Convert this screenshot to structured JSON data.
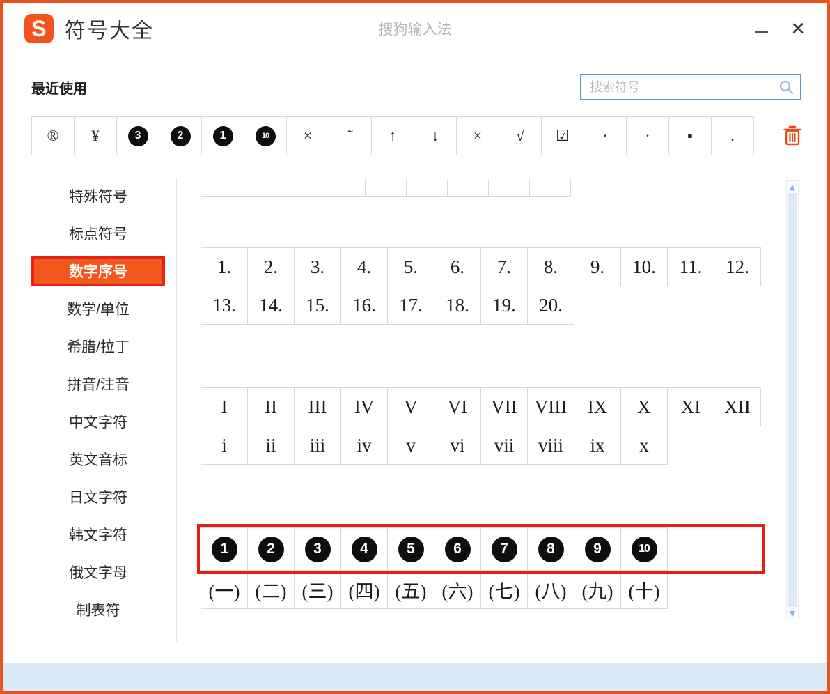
{
  "colors": {
    "accent_orange": "#e9511d",
    "highlight_red": "#e71f19",
    "search_border_blue": "#5b97d5",
    "selected_item_bg": "#f2571e"
  },
  "window": {
    "title": "符号大全",
    "center_title": "搜狗输入法",
    "close_glyph": "✕"
  },
  "toolbar": {
    "recent_label": "最近使用",
    "search_placeholder": "搜索符号"
  },
  "recent": {
    "symbols": [
      {
        "glyph": "®",
        "style": "plain"
      },
      {
        "glyph": "¥",
        "style": "plain"
      },
      {
        "glyph": "3",
        "style": "black-circle"
      },
      {
        "glyph": "2",
        "style": "black-circle"
      },
      {
        "glyph": "1",
        "style": "black-circle"
      },
      {
        "glyph": "10",
        "style": "black-circle"
      },
      {
        "glyph": "×",
        "style": "plain"
      },
      {
        "glyph": "˜",
        "style": "plain"
      },
      {
        "glyph": "↑",
        "style": "plain"
      },
      {
        "glyph": "↓",
        "style": "plain"
      },
      {
        "glyph": "×",
        "style": "plain"
      },
      {
        "glyph": "√",
        "style": "plain"
      },
      {
        "glyph": "☑",
        "style": "plain"
      },
      {
        "glyph": "·",
        "style": "plain"
      },
      {
        "glyph": "·",
        "style": "plain"
      },
      {
        "glyph": "▪",
        "style": "plain"
      },
      {
        "glyph": ".",
        "style": "plain"
      }
    ]
  },
  "sidebar": {
    "items": [
      {
        "label": "特殊符号",
        "selected": false
      },
      {
        "label": "标点符号",
        "selected": false
      },
      {
        "label": "数字序号",
        "selected": true
      },
      {
        "label": "数学/单位",
        "selected": false
      },
      {
        "label": "希腊/拉丁",
        "selected": false
      },
      {
        "label": "拼音/注音",
        "selected": false
      },
      {
        "label": "中文字符",
        "selected": false
      },
      {
        "label": "英文音标",
        "selected": false
      },
      {
        "label": "日文字符",
        "selected": false
      },
      {
        "label": "韩文字符",
        "selected": false
      },
      {
        "label": "俄文字母",
        "selected": false
      },
      {
        "label": "制表符",
        "selected": false
      }
    ]
  },
  "content": {
    "groups": [
      {
        "id": "partial-top",
        "rows": [
          {
            "partial": true,
            "cells": [
              "",
              "",
              "",
              "",
              "",
              "",
              "",
              "",
              ""
            ]
          }
        ]
      },
      {
        "id": "arabic-dot-numbers",
        "rows": [
          {
            "cells": [
              "1.",
              "2.",
              "3.",
              "4.",
              "5.",
              "6.",
              "7.",
              "8.",
              "9.",
              "10.",
              "11.",
              "12."
            ]
          },
          {
            "cells": [
              "13.",
              "14.",
              "15.",
              "16.",
              "17.",
              "18.",
              "19.",
              "20."
            ]
          }
        ]
      },
      {
        "id": "roman-numerals",
        "rows": [
          {
            "cells": [
              "I",
              "II",
              "III",
              "IV",
              "V",
              "VI",
              "VII",
              "VIII",
              "IX",
              "X",
              "XI",
              "XII"
            ]
          },
          {
            "cells": [
              "i",
              "ii",
              "iii",
              "iv",
              "v",
              "vi",
              "vii",
              "viii",
              "ix",
              "x"
            ]
          }
        ]
      },
      {
        "id": "circled-and-parenthesized",
        "rows": [
          {
            "highlighted": true,
            "cell_style": "black-circle",
            "cells": [
              "1",
              "2",
              "3",
              "4",
              "5",
              "6",
              "7",
              "8",
              "9",
              "10"
            ]
          },
          {
            "cells": [
              "(一)",
              "(二)",
              "(三)",
              "(四)",
              "(五)",
              "(六)",
              "(七)",
              "(八)",
              "(九)",
              "(十)"
            ]
          }
        ]
      }
    ]
  },
  "scrollbar": {
    "up_glyph": "▲",
    "down_glyph": "▼"
  }
}
